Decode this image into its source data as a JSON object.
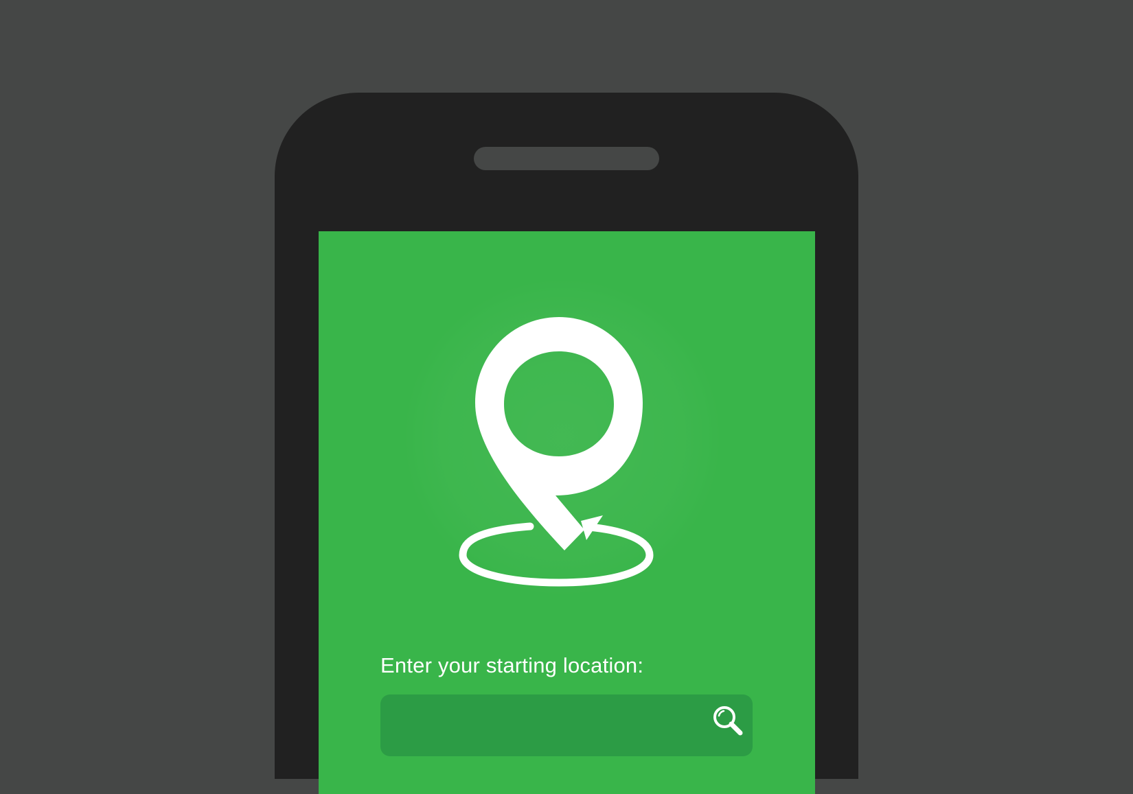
{
  "app": {
    "icon": "map-pin-loop-logo",
    "accent_color": "#39b54a",
    "background_color": "#454746",
    "phone_color": "#212121"
  },
  "location_form": {
    "prompt_label": "Enter your starting location:",
    "input_value": "",
    "input_placeholder": "",
    "search_icon": "magnifier-icon"
  }
}
